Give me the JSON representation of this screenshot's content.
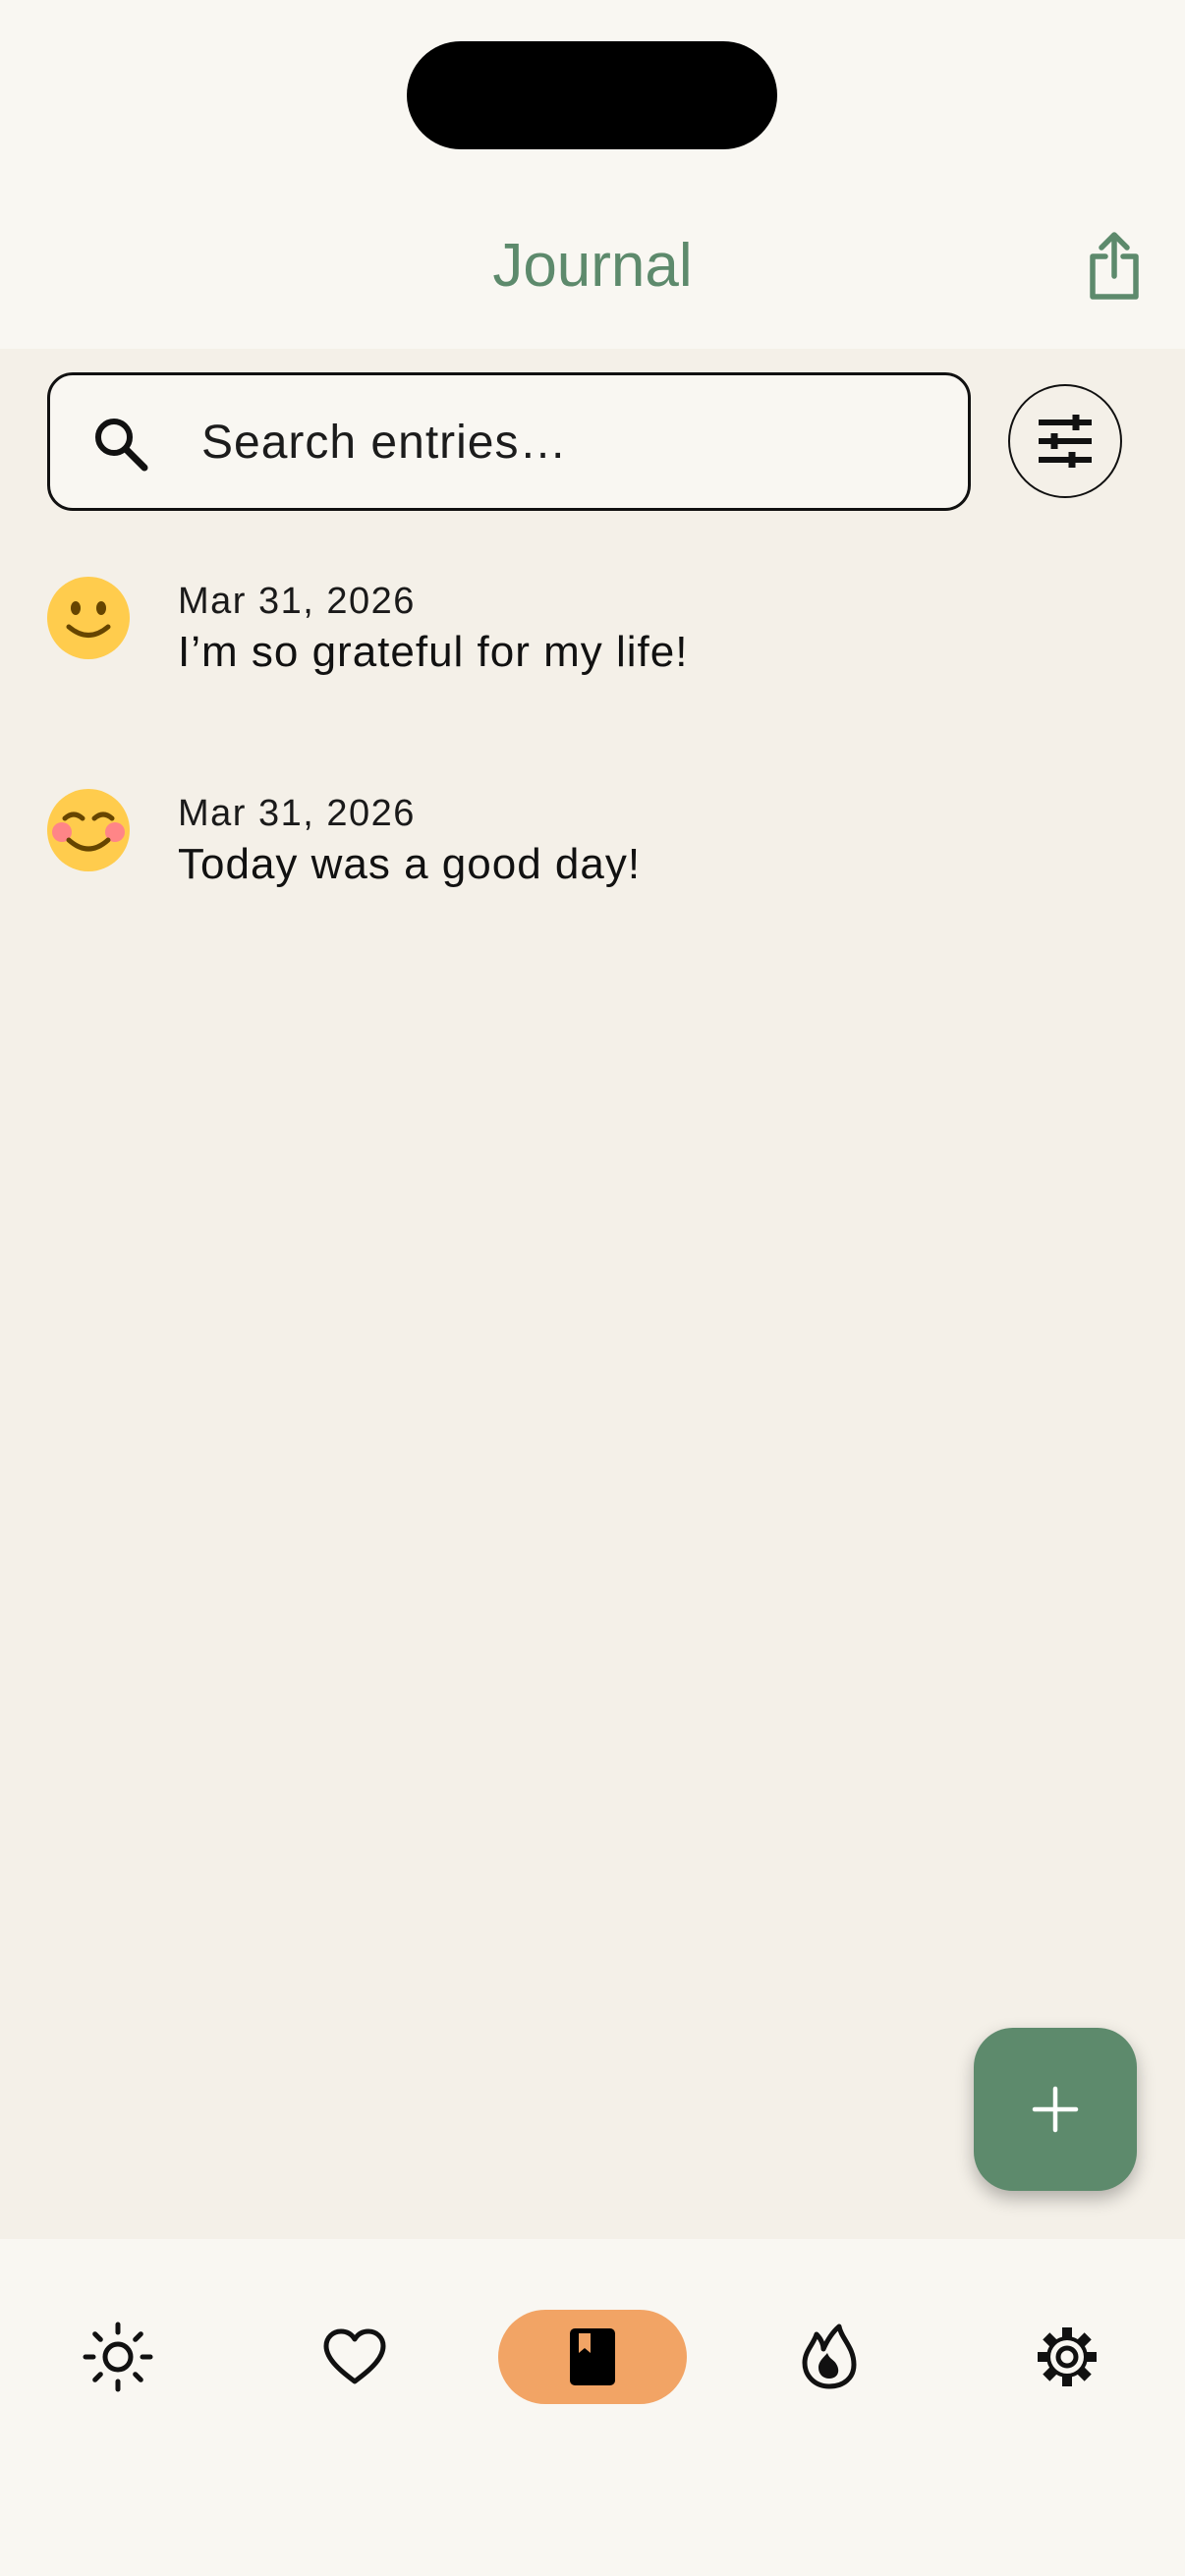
{
  "header": {
    "title": "Journal",
    "title_color": "#5d8a6c"
  },
  "search": {
    "placeholder": "Search entries…",
    "value": ""
  },
  "entries": [
    {
      "date": "Mar 31, 2026",
      "text": "I’m so grateful for my life!",
      "mood_icon": "slightly-smiling-face-icon"
    },
    {
      "date": "Mar 31, 2026",
      "text": "Today was a good day!",
      "mood_icon": "smiling-face-with-blush-icon"
    }
  ],
  "fab": {
    "icon": "plus-icon",
    "color": "#5d8a6c"
  },
  "bottom_nav": {
    "items": [
      {
        "icon": "sun-icon",
        "active": false
      },
      {
        "icon": "heart-icon",
        "active": false
      },
      {
        "icon": "journal-book-icon",
        "active": true
      },
      {
        "icon": "flame-icon",
        "active": false
      },
      {
        "icon": "gear-icon",
        "active": false
      }
    ],
    "active_color": "#f2a465"
  },
  "colors": {
    "background": "#f4f0e8",
    "surface": "#f9f7f2",
    "accent": "#5d8a6c",
    "emoji_yellow": "#ffcc4d"
  }
}
